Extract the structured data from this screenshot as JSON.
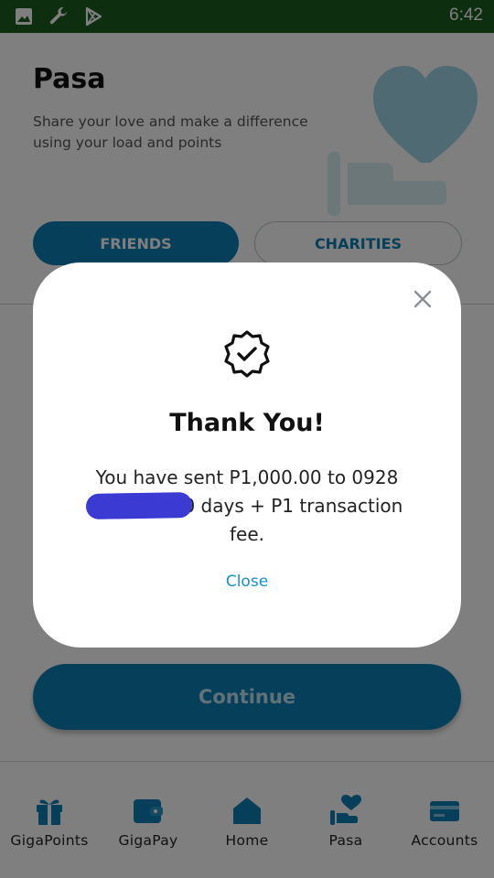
{
  "status_bar": {
    "time": "6:42",
    "icons": [
      "image-icon",
      "wrench-icon",
      "play-store-icon"
    ]
  },
  "header": {
    "title": "Pasa",
    "subtitle": "Share your love and make a difference using your load and points"
  },
  "tabs": [
    {
      "label": "FRIENDS",
      "selected": true
    },
    {
      "label": "CHARITIES",
      "selected": false
    }
  ],
  "primary_action": {
    "label": "Continue"
  },
  "bottom_nav": [
    {
      "label": "GigaPoints",
      "icon": "gift-icon",
      "active": false
    },
    {
      "label": "GigaPay",
      "icon": "wallet-icon",
      "active": false
    },
    {
      "label": "Home",
      "icon": "home-icon",
      "active": false
    },
    {
      "label": "Pasa",
      "icon": "hand-heart-icon",
      "active": true
    },
    {
      "label": "Accounts",
      "icon": "card-icon",
      "active": false
    }
  ],
  "modal": {
    "title": "Thank You!",
    "message": "You have sent P1,000.00 to 0928 valid for 60 days + P1 transaction fee.",
    "close_link": "Close"
  },
  "colors": {
    "brand": "#0d7fb3",
    "status_bar": "#1b5e20",
    "link": "#1a8fc4",
    "redaction": "#3b3bd4"
  }
}
